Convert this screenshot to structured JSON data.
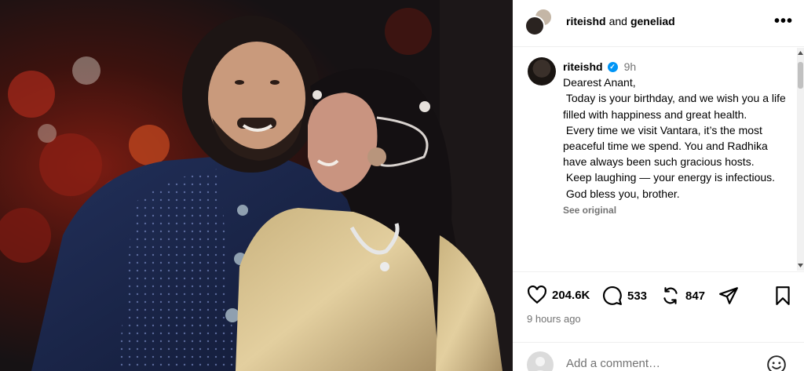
{
  "header": {
    "user1": "riteishd",
    "joiner": "and",
    "user2": "geneliad",
    "more": "•••"
  },
  "caption": {
    "username": "riteishd",
    "verified": "✓",
    "time": "9h",
    "lines": [
      "Dearest Anant,",
      " Today is your birthday, and we wish you a life filled with happiness and great health.",
      " Every time we visit Vantara, it’s the most peaceful time we spend. You and Radhika have always been such gracious hosts.",
      " Keep laughing — your energy is infectious.",
      " God bless you, brother."
    ],
    "see_original": "See original"
  },
  "actions": {
    "likes": "204.6K",
    "comments": "533",
    "reposts": "847"
  },
  "posted_ago": "9 hours ago",
  "comment_box": {
    "placeholder": "Add a comment…"
  },
  "colors": {
    "verified": "#0095f6",
    "secondary_text": "#737373",
    "divider": "#efefef"
  }
}
